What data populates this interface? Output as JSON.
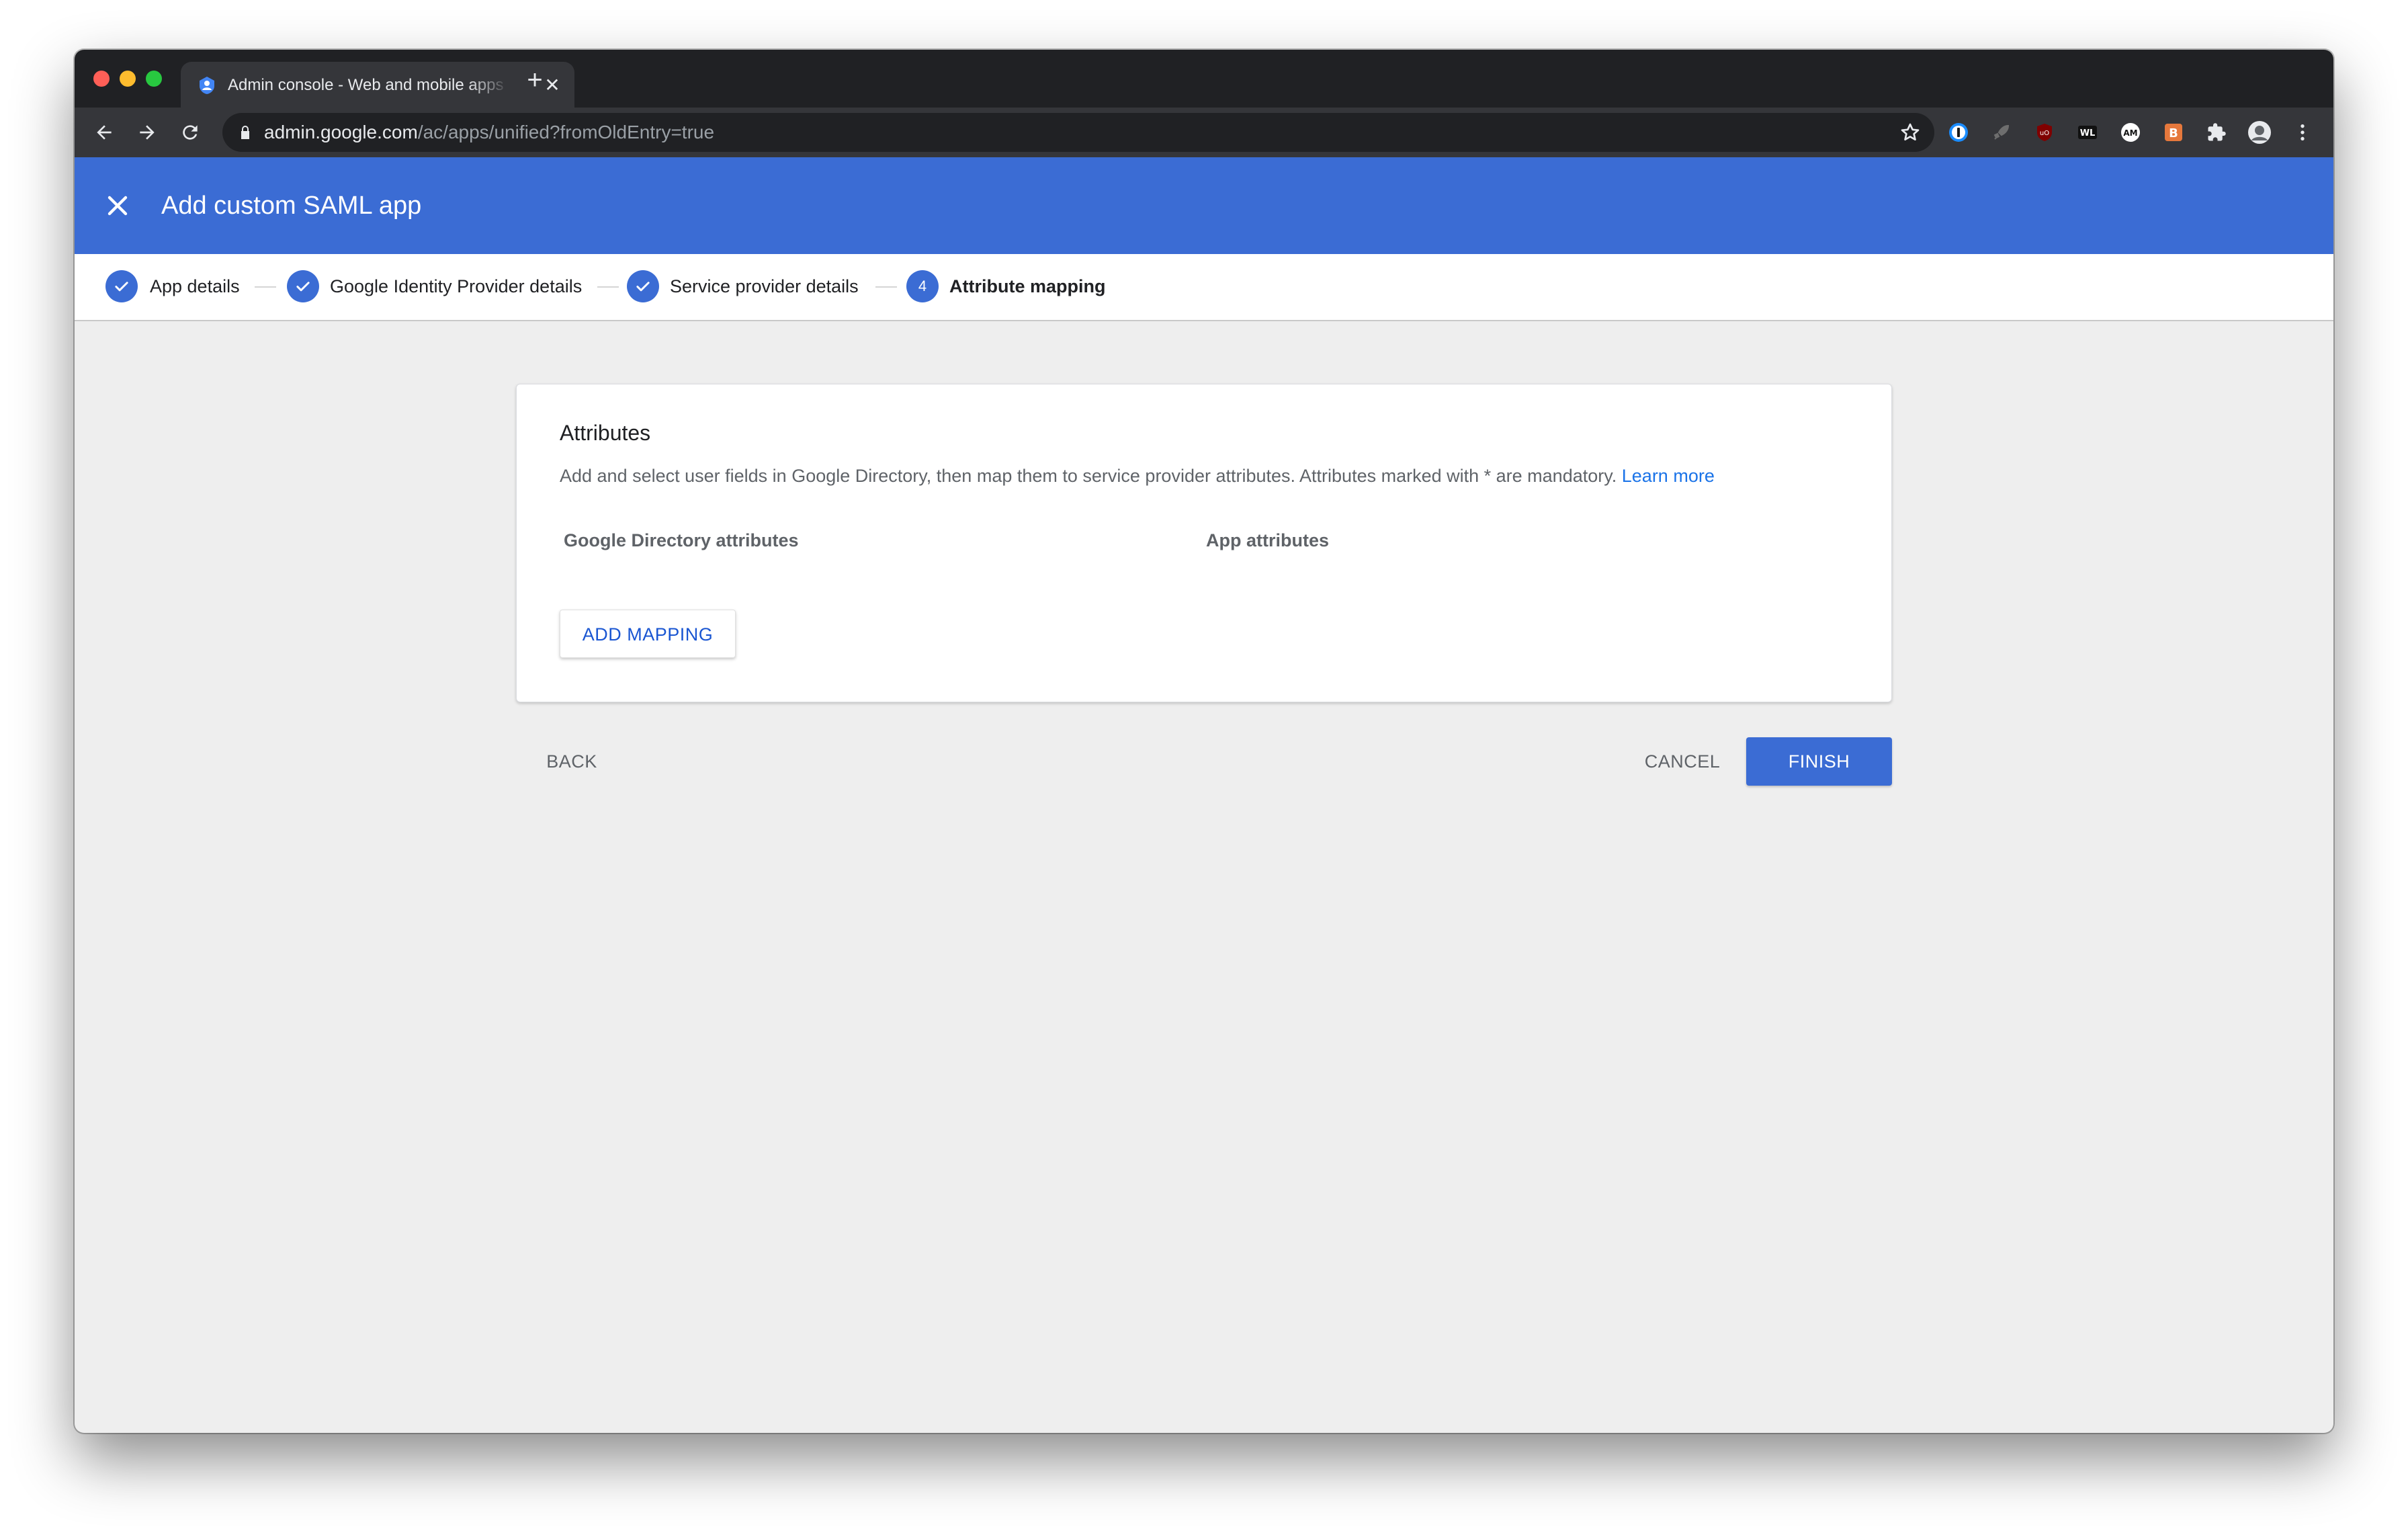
{
  "browser": {
    "tab_title": "Admin console - Web and mobile apps",
    "tab_close": "✕",
    "new_tab": "+",
    "url_host": "admin.google.com",
    "url_path": "/ac/apps/unified?fromOldEntry=true",
    "extensions": [
      "1password-icon",
      "rocket-icon",
      "ublock-icon",
      "wl-icon",
      "am-icon",
      "b-icon",
      "puzzle-icon",
      "profile-avatar",
      "menu-kebab-icon"
    ]
  },
  "header": {
    "title": "Add custom SAML app",
    "close_icon": "close-icon"
  },
  "stepper": {
    "steps": [
      {
        "label": "App details",
        "state": "done"
      },
      {
        "label": "Google Identity Provider details",
        "state": "done"
      },
      {
        "label": "Service provider details",
        "state": "done"
      },
      {
        "label": "Attribute mapping",
        "state": "active",
        "number": "4"
      }
    ]
  },
  "card": {
    "title": "Attributes",
    "description": "Add and select user fields in Google Directory, then map them to service provider attributes. Attributes marked with * are mandatory.",
    "learn_more": "Learn more",
    "col_google": "Google Directory attributes",
    "col_app": "App attributes",
    "add_mapping": "ADD MAPPING"
  },
  "footer": {
    "back": "BACK",
    "cancel": "CANCEL",
    "finish": "FINISH"
  },
  "colors": {
    "accent": "#3b6cd4",
    "link": "#1a73e8",
    "chrome_dark": "#202124",
    "page_bg": "#eeeeee"
  }
}
